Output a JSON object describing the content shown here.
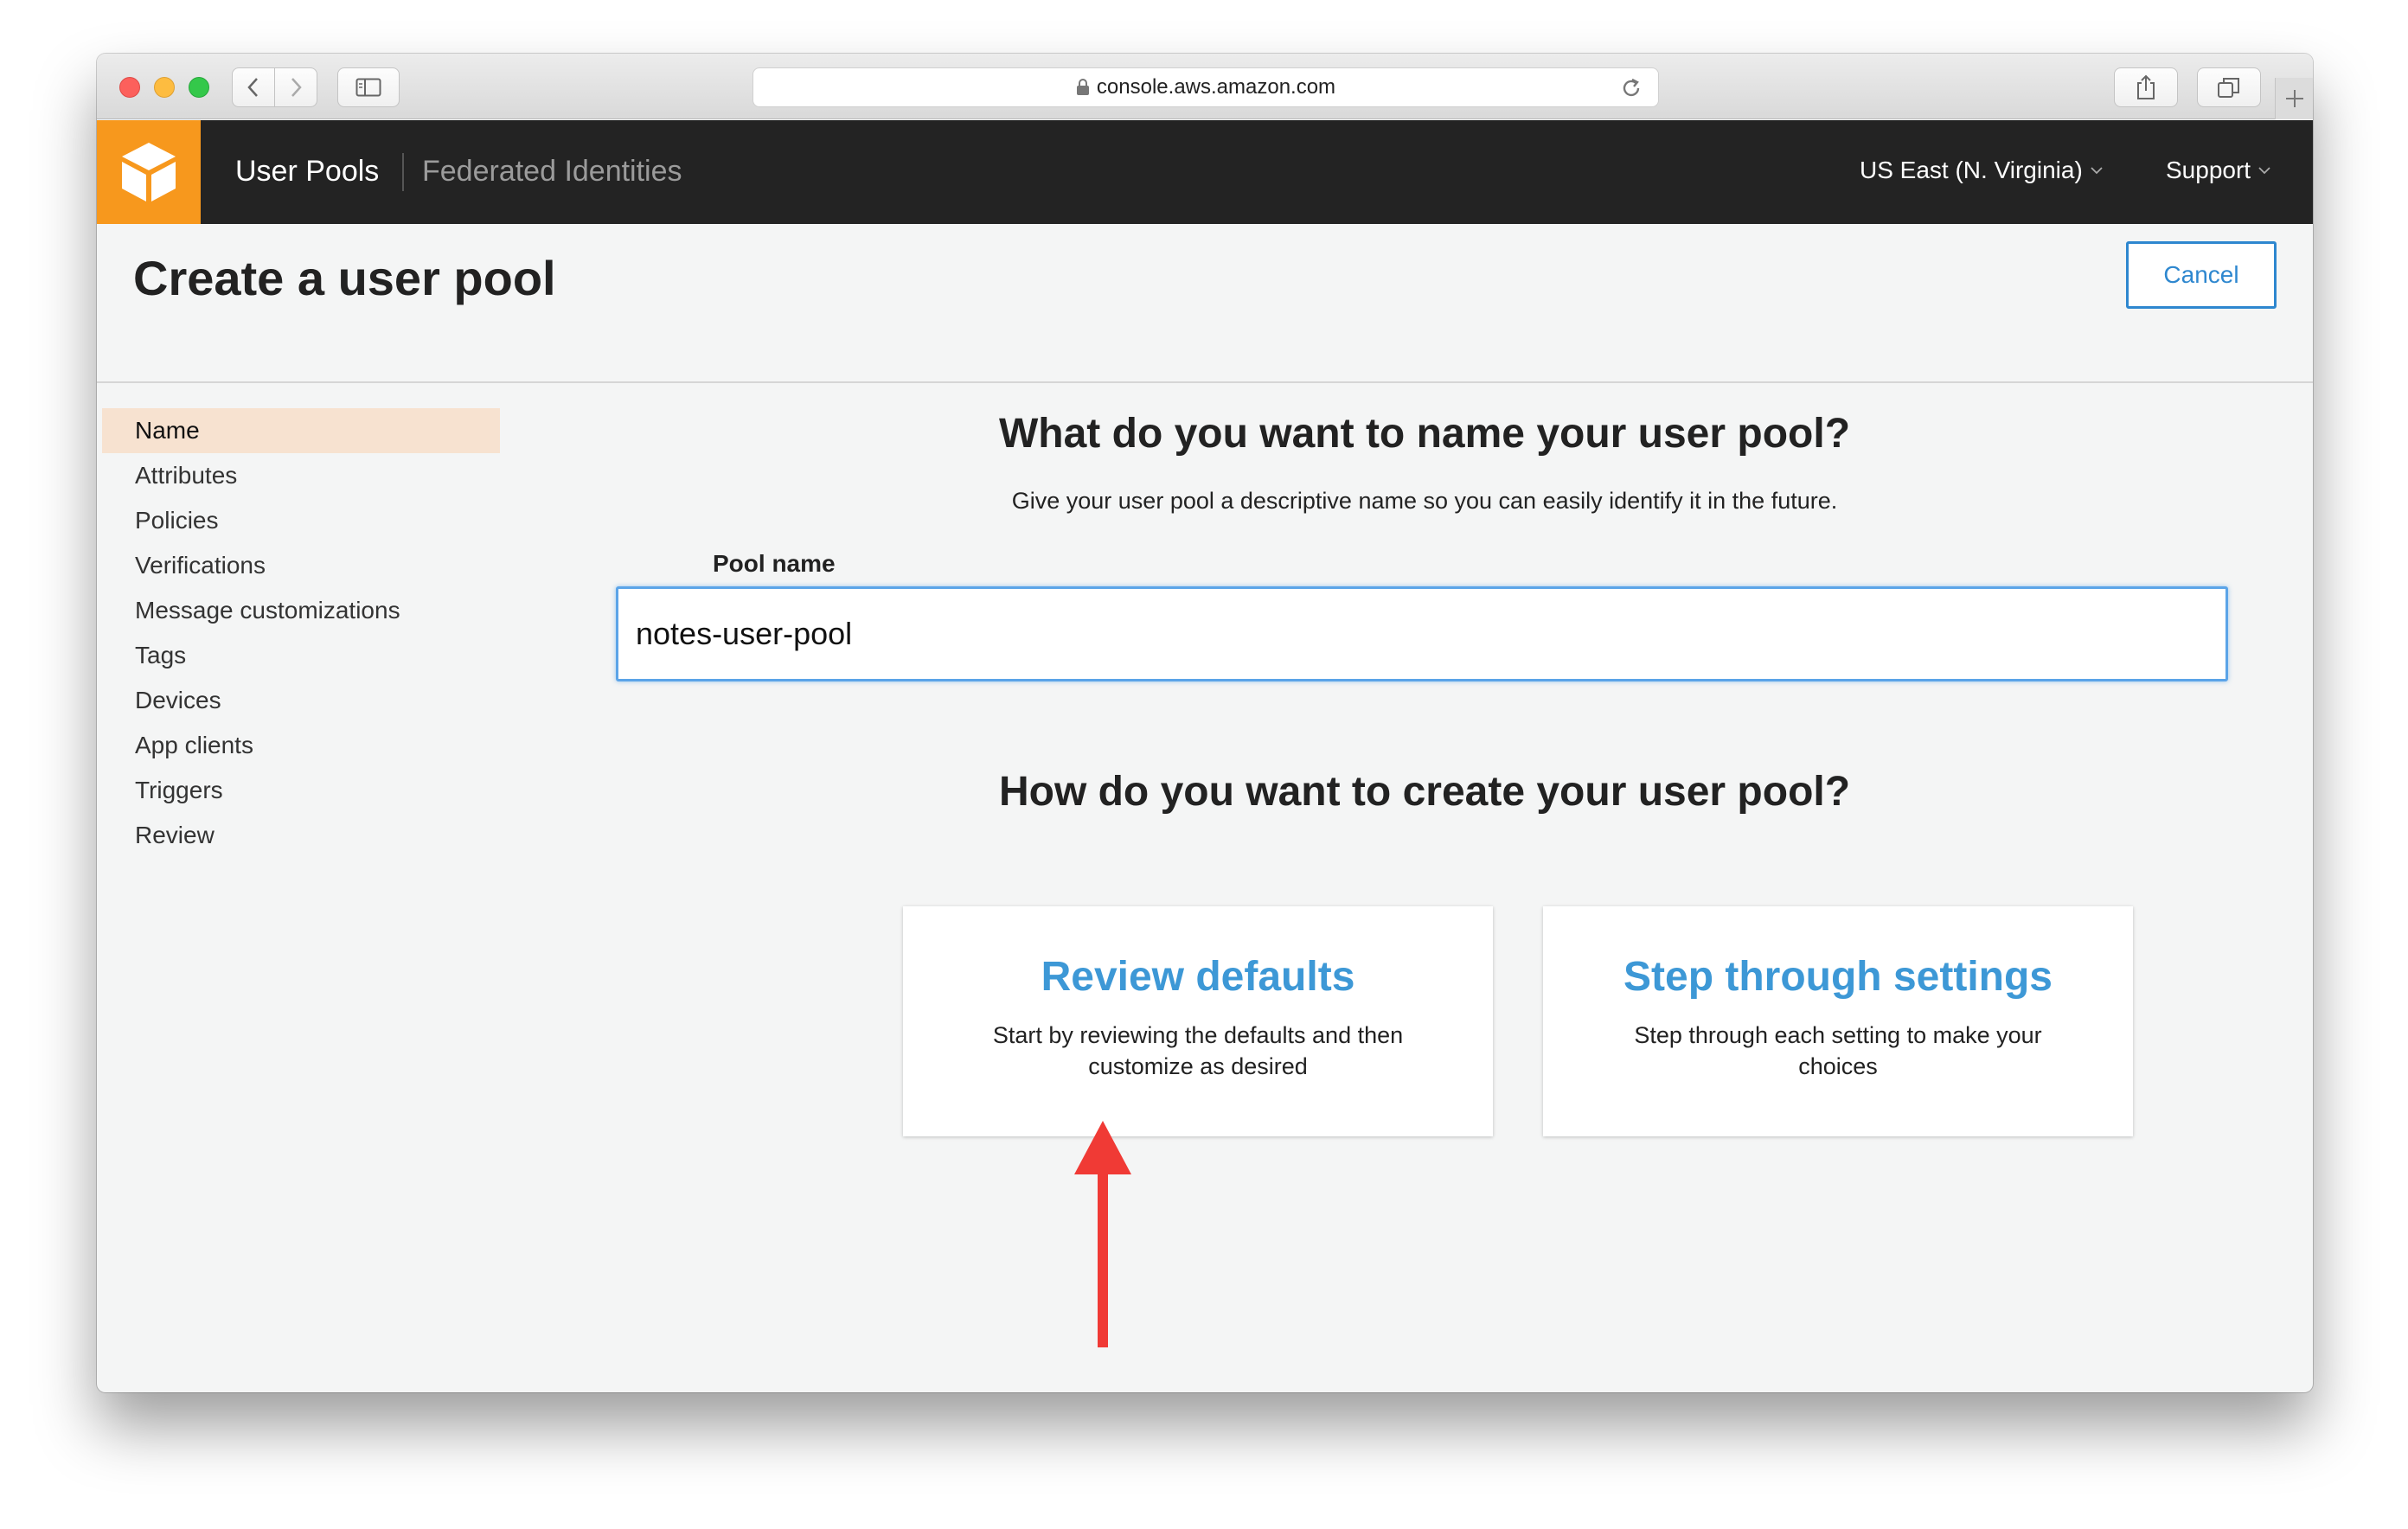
{
  "browser": {
    "url": "console.aws.amazon.com"
  },
  "header": {
    "nav_primary": "User Pools",
    "nav_secondary": "Federated Identities",
    "region": "US East (N. Virginia)",
    "support": "Support"
  },
  "page": {
    "title": "Create a user pool",
    "cancel_label": "Cancel"
  },
  "sidebar": {
    "items": [
      {
        "label": "Name",
        "active": true
      },
      {
        "label": "Attributes"
      },
      {
        "label": "Policies"
      },
      {
        "label": "Verifications"
      },
      {
        "label": "Message customizations"
      },
      {
        "label": "Tags"
      },
      {
        "label": "Devices"
      },
      {
        "label": "App clients"
      },
      {
        "label": "Triggers"
      },
      {
        "label": "Review"
      }
    ]
  },
  "main": {
    "name_question": "What do you want to name your user pool?",
    "name_hint": "Give your user pool a descriptive name so you can easily identify it in the future.",
    "pool_name_label": "Pool name",
    "pool_name_value": "notes-user-pool",
    "create_question": "How do you want to create your user pool?",
    "options": [
      {
        "title": "Review defaults",
        "description": "Start by reviewing the defaults and then customize as desired"
      },
      {
        "title": "Step through settings",
        "description": "Step through each setting to make your choices"
      }
    ]
  },
  "colors": {
    "aws_orange": "#f7981d",
    "header_dark": "#232323",
    "link_blue": "#3d98d6",
    "active_nav_bg": "#f7e2d0",
    "annotation_arrow": "#f03a35"
  },
  "icons": [
    "aws-cube-icon",
    "lock-icon",
    "reload-icon",
    "share-icon",
    "tabs-icon",
    "sidebar-icon",
    "chevron-down-icon",
    "annotation-arrow-icon"
  ]
}
